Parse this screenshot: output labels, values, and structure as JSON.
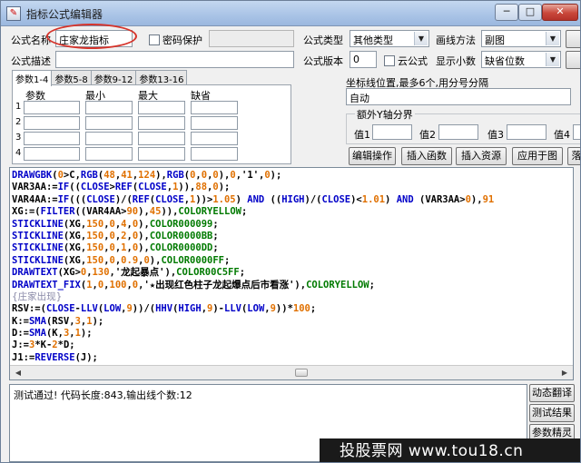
{
  "window": {
    "title": "指标公式编辑器",
    "min_glyph": "─",
    "max_glyph": "□",
    "close_glyph": "✕"
  },
  "form": {
    "name_label": "公式名称",
    "name_value": "庄家龙指标",
    "password_label": "密码保护",
    "desc_label": "公式描述",
    "type_label": "公式类型",
    "type_value": "其他类型",
    "draw_label": "画线方法",
    "draw_value": "副图",
    "version_label": "公式版本",
    "version_value": "0",
    "cloud_label": "云公式",
    "decimals_label": "显示小数",
    "decimals_value": "缺省位数"
  },
  "tabs": [
    "参数1-4",
    "参数5-8",
    "参数9-12",
    "参数13-16"
  ],
  "params": {
    "headers": [
      "参数",
      "最小",
      "最大",
      "缺省"
    ],
    "rows": [
      "1",
      "2",
      "3",
      "4"
    ]
  },
  "axis": {
    "label": "坐标线位置,最多6个,用分号分隔",
    "value": "自动",
    "group_title": "额外Y轴分界",
    "values": [
      "值1",
      "值2",
      "值3",
      "值4"
    ]
  },
  "actions": {
    "edit": "编辑操作",
    "insert_func": "插入函数",
    "insert_res": "插入资源",
    "apply": "应用于图",
    "more": "落"
  },
  "code": [
    "DRAWGBK(0>C,RGB(48,41,124),RGB(0,0,0),0,'1',0);",
    "VAR3AA:=IF((CLOSE>REF(CLOSE,1)),88,0);",
    "VAR4AA:=IF(((CLOSE)/(REF(CLOSE,1))>1.05) AND ((HIGH)/(CLOSE)<1.01) AND (VAR3AA>0),91",
    "XG:=(FILTER((VAR4AA>90),45)),COLORYELLOW;",
    "STICKLINE(XG,150,0,4,0),COLOR000099;",
    "STICKLINE(XG,150,0,2,0),COLOR0000BB;",
    "STICKLINE(XG,150,0,1,0),COLOR0000DD;",
    "STICKLINE(XG,150,0,0.9,0),COLOR0000FF;",
    "DRAWTEXT(XG>0,130,'龙起暴点'),COLOR00C5FF;",
    "DRAWTEXT_FIX(1,0,100,0,'★出现红色柱子龙起爆点后市看涨'),COLORYELLOW;",
    "{庄家出现}",
    "RSV:=(CLOSE-LLV(LOW,9))/(HHV(HIGH,9)-LLV(LOW,9))*100;",
    "K:=SMA(RSV,3,1);",
    "D:=SMA(K,3,1);",
    "J:=3*K-2*D;",
    "J1:=REVERSE(J);"
  ],
  "colors": {
    "keyword": "#0000c8",
    "number": "#e07000",
    "function": "#007a00",
    "text": "#000000",
    "comment": "#8a8aa8"
  },
  "status": {
    "message": "测试通过! 代码长度:843,输出线个数:12"
  },
  "side_buttons": [
    "动态翻译",
    "测试结果",
    "参数精灵"
  ],
  "watermark": {
    "text": "投股票网 www.tou18.cn"
  }
}
